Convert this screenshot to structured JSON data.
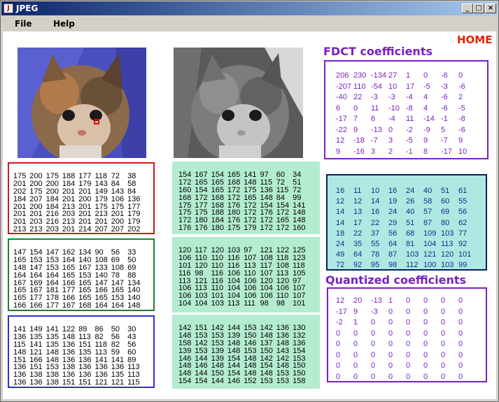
{
  "window": {
    "title": "JPEG",
    "icon": "app-icon",
    "controls": [
      "minimize-icon",
      "maximize-icon",
      "close-icon"
    ]
  },
  "menu": {
    "file": "File",
    "help": "Help"
  },
  "home_link": "HOME",
  "colors": {
    "purple": "#7a1fc4",
    "home": "#e82000",
    "mint": "#b3ecd0",
    "quant_bg": "#ade9e2"
  },
  "images": {
    "color_image": "kitten-color-image",
    "gray_image": "kitten-grayscale-image"
  },
  "blocks": {
    "red": [
      [
        175,
        200,
        175,
        188,
        177,
        118,
        72,
        38
      ],
      [
        201,
        200,
        200,
        184,
        179,
        143,
        84,
        58
      ],
      [
        202,
        175,
        200,
        201,
        201,
        149,
        143,
        84
      ],
      [
        184,
        207,
        184,
        201,
        200,
        179,
        106,
        136
      ],
      [
        201,
        200,
        184,
        213,
        201,
        175,
        175,
        177
      ],
      [
        201,
        201,
        216,
        203,
        201,
        213,
        201,
        179
      ],
      [
        201,
        203,
        216,
        213,
        201,
        201,
        200,
        179
      ],
      [
        213,
        213,
        203,
        201,
        214,
        207,
        207,
        202
      ]
    ],
    "green": [
      [
        147,
        154,
        147,
        162,
        134,
        90,
        56,
        33
      ],
      [
        165,
        153,
        153,
        164,
        140,
        108,
        69,
        50
      ],
      [
        148,
        147,
        153,
        165,
        167,
        133,
        108,
        69
      ],
      [
        164,
        164,
        164,
        165,
        153,
        140,
        78,
        88
      ],
      [
        167,
        169,
        164,
        166,
        165,
        147,
        147,
        134
      ],
      [
        165,
        167,
        181,
        177,
        165,
        166,
        165,
        140
      ],
      [
        165,
        177,
        178,
        166,
        165,
        165,
        153,
        140
      ],
      [
        166,
        166,
        177,
        167,
        168,
        164,
        164,
        148
      ]
    ],
    "blue": [
      [
        141,
        149,
        141,
        122,
        89,
        86,
        50,
        30
      ],
      [
        136,
        135,
        135,
        148,
        113,
        82,
        56,
        43
      ],
      [
        115,
        141,
        135,
        136,
        151,
        118,
        82,
        56
      ],
      [
        148,
        121,
        148,
        136,
        135,
        113,
        59,
        60
      ],
      [
        151,
        166,
        148,
        136,
        136,
        141,
        141,
        89
      ],
      [
        136,
        151,
        153,
        138,
        136,
        136,
        136,
        113
      ],
      [
        136,
        138,
        138,
        136,
        136,
        136,
        135,
        113
      ],
      [
        136,
        136,
        138,
        151,
        151,
        121,
        121,
        115
      ]
    ],
    "gray": [
      [
        154,
        167,
        154,
        165,
        141,
        97,
        60,
        34
      ],
      [
        172,
        165,
        165,
        168,
        148,
        115,
        72,
        51
      ],
      [
        160,
        154,
        165,
        172,
        175,
        136,
        115,
        72
      ],
      [
        168,
        172,
        168,
        172,
        165,
        148,
        84,
        99
      ],
      [
        175,
        177,
        168,
        176,
        172,
        154,
        154,
        141
      ],
      [
        175,
        175,
        188,
        180,
        172,
        176,
        172,
        148
      ],
      [
        172,
        180,
        184,
        176,
        172,
        172,
        165,
        148
      ],
      [
        176,
        176,
        180,
        175,
        179,
        172,
        172,
        160
      ]
    ],
    "shifted": [
      [
        120,
        117,
        120,
        103,
        97,
        121,
        122,
        125
      ],
      [
        106,
        110,
        110,
        116,
        107,
        108,
        118,
        123
      ],
      [
        101,
        120,
        110,
        116,
        113,
        117,
        108,
        118
      ],
      [
        116,
        98,
        116,
        106,
        110,
        107,
        113,
        105
      ],
      [
        113,
        121,
        116,
        104,
        106,
        120,
        120,
        97
      ],
      [
        106,
        113,
        110,
        104,
        106,
        104,
        106,
        107
      ],
      [
        106,
        103,
        101,
        104,
        106,
        106,
        110,
        107
      ],
      [
        104,
        104,
        103,
        113,
        111,
        98,
        98,
        101
      ]
    ],
    "reconstructed": [
      [
        142,
        151,
        142,
        144,
        153,
        142,
        136,
        130
      ],
      [
        148,
        153,
        153,
        139,
        150,
        148,
        136,
        132
      ],
      [
        158,
        142,
        153,
        148,
        146,
        137,
        148,
        136
      ],
      [
        139,
        153,
        139,
        148,
        153,
        150,
        143,
        154
      ],
      [
        146,
        144,
        139,
        154,
        148,
        142,
        142,
        153
      ],
      [
        148,
        146,
        148,
        144,
        148,
        154,
        148,
        150
      ],
      [
        148,
        144,
        150,
        154,
        148,
        148,
        153,
        150
      ],
      [
        154,
        154,
        144,
        146,
        152,
        153,
        153,
        158
      ]
    ]
  },
  "fdct": {
    "title": "FDCT coefficients",
    "rows": [
      [
        206,
        230,
        -134,
        27,
        1,
        0,
        -6,
        0
      ],
      [
        -207,
        110,
        -54,
        10,
        17,
        -5,
        -3,
        -6
      ],
      [
        -40,
        22,
        -3,
        -3,
        -4,
        4,
        -6,
        2
      ],
      [
        6,
        0,
        11,
        -10,
        -8,
        4,
        -6,
        -5
      ],
      [
        -17,
        7,
        6,
        -4,
        11,
        -14,
        -1,
        -8
      ],
      [
        -22,
        9,
        -13,
        0,
        -2,
        -9,
        5,
        -6
      ],
      [
        12,
        -18,
        -7,
        3,
        -5,
        9,
        -7,
        9
      ],
      [
        9,
        -16,
        3,
        2,
        -1,
        8,
        -17,
        10
      ]
    ]
  },
  "quant_table": [
    [
      16,
      11,
      10,
      16,
      24,
      40,
      51,
      61
    ],
    [
      12,
      12,
      14,
      19,
      26,
      58,
      60,
      55
    ],
    [
      14,
      13,
      16,
      24,
      40,
      57,
      69,
      56
    ],
    [
      14,
      17,
      22,
      29,
      51,
      87,
      80,
      62
    ],
    [
      18,
      22,
      37,
      56,
      68,
      109,
      103,
      77
    ],
    [
      24,
      35,
      55,
      64,
      81,
      104,
      113,
      92
    ],
    [
      49,
      64,
      78,
      87,
      103,
      121,
      120,
      101
    ],
    [
      72,
      92,
      95,
      98,
      112,
      100,
      103,
      99
    ]
  ],
  "quantized": {
    "title": "Quantized coefficients",
    "rows": [
      [
        12,
        20,
        -13,
        1,
        0,
        0,
        0,
        0
      ],
      [
        -17,
        9,
        -3,
        0,
        0,
        0,
        0,
        0
      ],
      [
        -2,
        1,
        0,
        0,
        0,
        0,
        0,
        0
      ],
      [
        0,
        0,
        0,
        0,
        0,
        0,
        0,
        0
      ],
      [
        0,
        0,
        0,
        0,
        0,
        0,
        0,
        0
      ],
      [
        0,
        0,
        0,
        0,
        0,
        0,
        0,
        0
      ],
      [
        0,
        0,
        0,
        0,
        0,
        0,
        0,
        0
      ],
      [
        0,
        0,
        0,
        0,
        0,
        0,
        0,
        0
      ]
    ]
  }
}
